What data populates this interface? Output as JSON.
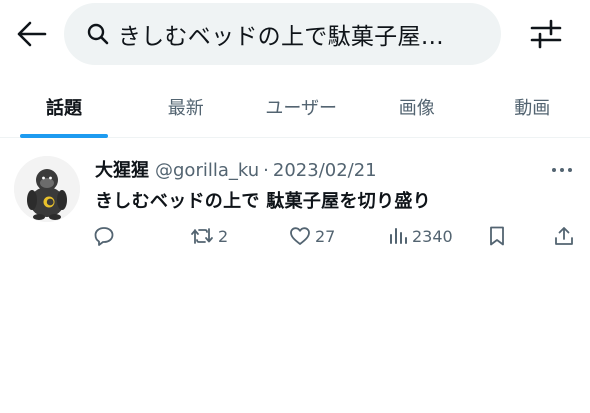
{
  "search": {
    "query": "きしむベッドの上で駄菓子屋…"
  },
  "tabs": [
    {
      "label": "話題",
      "active": true
    },
    {
      "label": "最新",
      "active": false
    },
    {
      "label": "ユーザー",
      "active": false
    },
    {
      "label": "画像",
      "active": false
    },
    {
      "label": "動画",
      "active": false
    }
  ],
  "tweet": {
    "display_name": "大猩猩",
    "handle": "@gorilla_ku",
    "separator": "·",
    "date": "2023/02/21",
    "text": "きしむベッドの上で 駄菓子屋を切り盛り",
    "retweets": "2",
    "likes": "27",
    "views": "2340"
  },
  "colors": {
    "accent": "#1d9bf0",
    "text_primary": "#0f1419",
    "text_secondary": "#536471",
    "search_bg": "#eff3f4"
  },
  "icons": {
    "back": "arrow-left-icon",
    "search": "search-icon",
    "filter": "sliders-icon",
    "more": "more-dots-icon",
    "reply": "reply-icon",
    "retweet": "retweet-icon",
    "like": "heart-icon",
    "views": "views-chart-icon",
    "bookmark": "bookmark-icon",
    "share": "share-icon"
  }
}
